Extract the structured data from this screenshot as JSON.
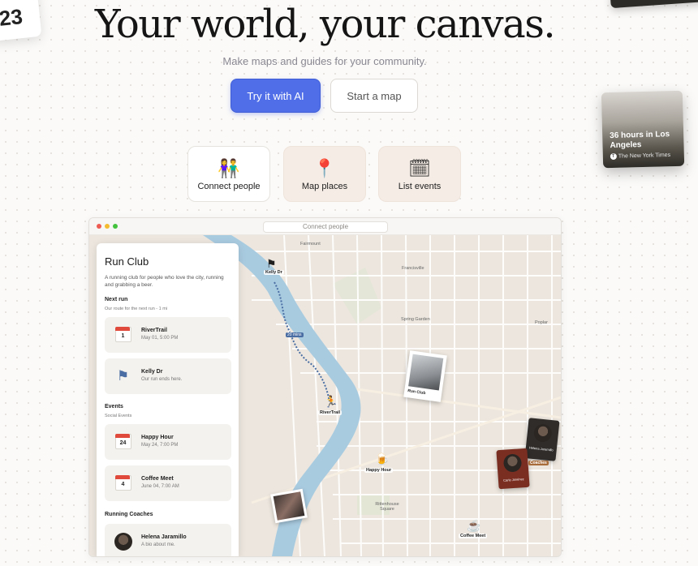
{
  "corner": {
    "left_text": "23"
  },
  "hero": {
    "title": "Your world, your canvas.",
    "subtitle": "Make maps and guides for your community.",
    "primary_button": "Try it with AI",
    "secondary_button": "Start a map"
  },
  "features": [
    {
      "label": "Connect people",
      "icon": "people-icon",
      "glyph": "👫"
    },
    {
      "label": "Map places",
      "icon": "map-pin-icon",
      "glyph": "📍"
    },
    {
      "label": "List events",
      "icon": "calendar-icon",
      "glyph": "🗓"
    }
  ],
  "la_card": {
    "title": "36 hours in Los Angeles",
    "source": "The New York Times",
    "source_mark": "T"
  },
  "window": {
    "url_text": "Connect people",
    "traffic_lights": [
      "#ee5b52",
      "#f3bb2f",
      "#43c23e"
    ]
  },
  "panel": {
    "title": "Run Club",
    "description": "A running club for people who love the city, running and grabbing a beer.",
    "next_run_heading": "Next run",
    "next_run_sub": "Our route for the next run - 1 mi",
    "route_items": [
      {
        "name": "RiverTrail",
        "detail": "May 01, 5:00 PM",
        "cal_day": "1",
        "cal_month": "MAY"
      },
      {
        "name": "Kelly Dr",
        "detail": "Our run ends here."
      }
    ],
    "events_heading": "Events",
    "events_sub": "Social Events",
    "event_items": [
      {
        "name": "Happy Hour",
        "detail": "May 24, 7:00 PM",
        "cal_day": "24",
        "cal_month": "MAY"
      },
      {
        "name": "Coffee Meet",
        "detail": "June 04, 7:00 AM",
        "cal_day": "4",
        "cal_month": "JUN"
      }
    ],
    "coaches_heading": "Running Coaches",
    "coach_items": [
      {
        "name": "Helena Jaramillo",
        "detail": "A bio about me."
      }
    ]
  },
  "map": {
    "labels": {
      "kelly_dr": "Kelly Dr",
      "distance": "20 mins",
      "rivertrail": "RiverTrail",
      "run_club": "Run Club",
      "happy_hour": "Happy Hour",
      "coffee_meet": "Coffee Meet",
      "coach_tag": "Coaches",
      "coach1": "Helena Jaramillo",
      "coach2": "Carlo Jiménez",
      "area_fairmount": "Fairmount",
      "area_francisville": "Francisville",
      "area_spring_garden": "Spring Garden",
      "area_poplar": "Poplar",
      "area_rittenhouse": "Rittenhouse Square"
    }
  },
  "colors": {
    "accent": "#4f6ee8",
    "map_bg": "#ece6de",
    "river": "#a9cbe0",
    "calendar_red": "#e04a3c"
  }
}
